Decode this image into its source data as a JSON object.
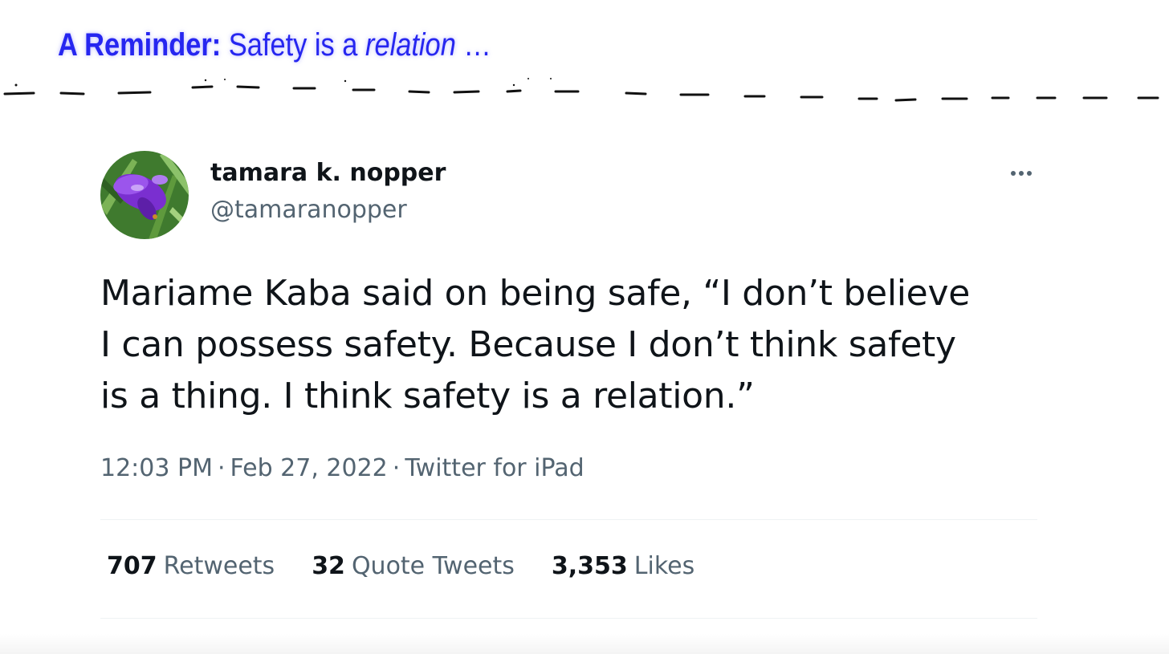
{
  "heading": {
    "bold": "A Reminder:",
    "normal": "Safety is a",
    "italic": "relation",
    "ellipsis": "…"
  },
  "colors": {
    "heading": "#2626f0",
    "text_primary": "#0f1419",
    "text_secondary": "#536471",
    "divider": "#eff3f4"
  },
  "tweet": {
    "author_name": "tamara k. nopper",
    "author_handle": "@tamaranopper",
    "avatar_icon": "purple-flower-avatar",
    "more_icon": "more-options-icon",
    "text_lines": [
      "Mariame Kaba said on being safe, “I don’t believe",
      "I can possess safety. Because I don’t think safety",
      "is a thing. I think safety is a relation.”"
    ],
    "time": "12:03 PM",
    "date": "Feb 27, 2022",
    "source": "Twitter for iPad",
    "separator": "·",
    "stats": {
      "retweets_count": "707",
      "retweets_label": "Retweets",
      "quotes_count": "32",
      "quotes_label": "Quote Tweets",
      "likes_count": "3,353",
      "likes_label": "Likes"
    }
  }
}
